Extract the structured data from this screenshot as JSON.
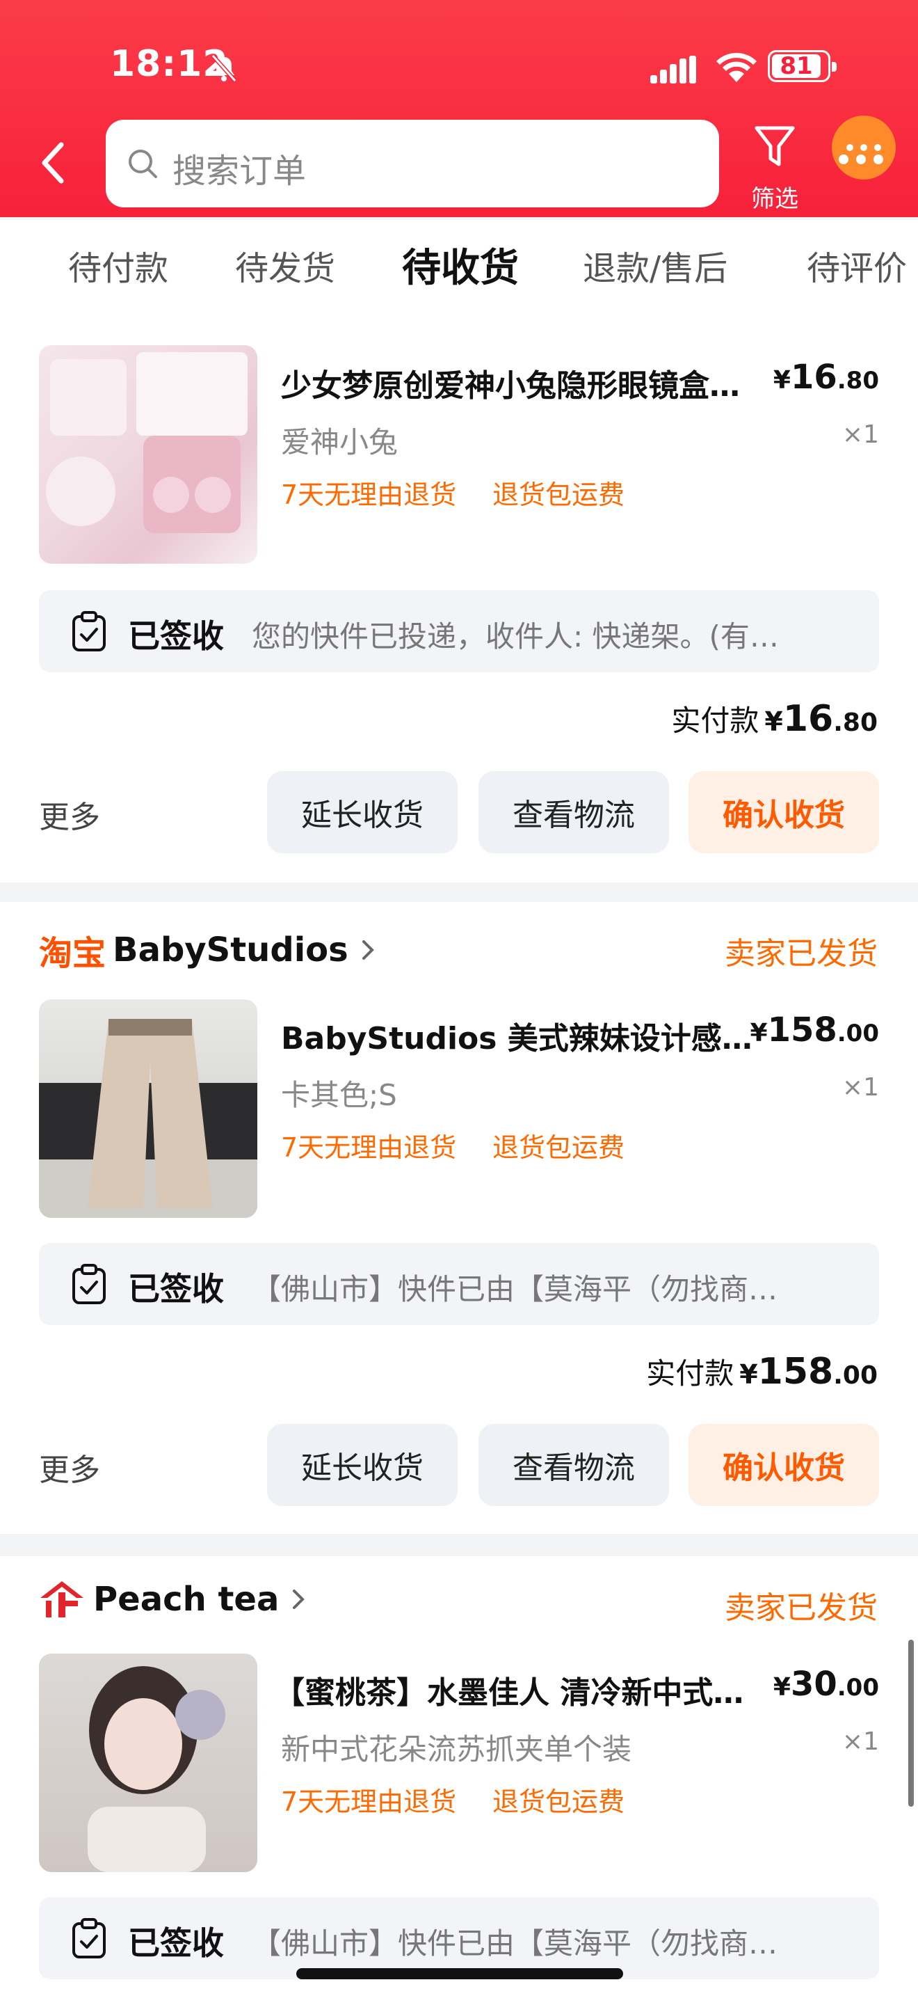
{
  "status_bar": {
    "time": "18:12",
    "battery": "81"
  },
  "header": {
    "search_placeholder": "搜索订单",
    "filter_label": "筛选"
  },
  "tabs": [
    {
      "label": "待付款"
    },
    {
      "label": "待发货"
    },
    {
      "label": "待收货"
    },
    {
      "label": "退款/售后"
    },
    {
      "label": "待评价"
    }
  ],
  "orders": [
    {
      "product_title": "少女梦原创爱神小兔隐形眼镜盒…",
      "price_yen": "¥",
      "price_int": "16",
      "price_cents": ".80",
      "sku": "爱神小兔",
      "qty": "×1",
      "tag1": "7天无理由退货",
      "tag2": "退货包运费",
      "logistics_status": "已签收",
      "logistics_detail": "您的快件已投递，收件人: 快递架。(有…",
      "paid_label": "实付款",
      "paid_yen": "¥",
      "paid_int": "16",
      "paid_cents": ".80",
      "more": "更多",
      "btn_extend": "延长收货",
      "btn_logistics": "查看物流",
      "btn_confirm": "确认收货"
    },
    {
      "shop_logo": "淘宝",
      "shop_name": "BabyStudios",
      "shop_status": "卖家已发货",
      "product_title": "BabyStudios 美式辣妹设计感…",
      "price_yen": "¥",
      "price_int": "158",
      "price_cents": ".00",
      "sku": "卡其色;S",
      "qty": "×1",
      "tag1": "7天无理由退货",
      "tag2": "退货包运费",
      "logistics_status": "已签收",
      "logistics_detail": "【佛山市】快件已由【莫海平（勿找商…",
      "paid_label": "实付款",
      "paid_yen": "¥",
      "paid_int": "158",
      "paid_cents": ".00",
      "more": "更多",
      "btn_extend": "延长收货",
      "btn_logistics": "查看物流",
      "btn_confirm": "确认收货"
    },
    {
      "shop_name": "Peach tea",
      "shop_status": "卖家已发货",
      "product_title": "【蜜桃茶】水墨佳人 清冷新中式…",
      "price_yen": "¥",
      "price_int": "30",
      "price_cents": ".00",
      "sku": "新中式花朵流苏抓夹单个装",
      "qty": "×1",
      "tag1": "7天无理由退货",
      "tag2": "退货包运费",
      "logistics_status": "已签收",
      "logistics_detail": "【佛山市】快件已由【莫海平（勿找商…"
    }
  ],
  "colors": {
    "header_red": "#f7203a",
    "accent_orange": "#ff6a00",
    "confirm_bg": "#fff0e6"
  }
}
